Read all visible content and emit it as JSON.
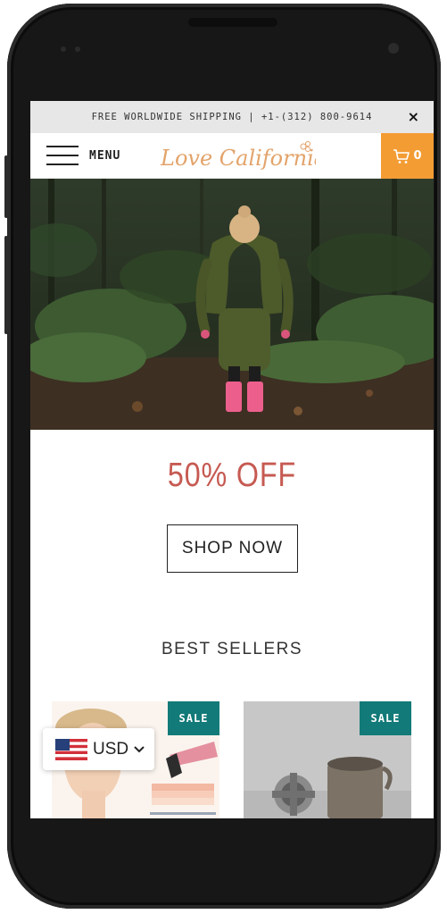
{
  "announcement": {
    "text": "FREE WORLDWIDE SHIPPING | +1-(312) 800-9614",
    "close_label": "×"
  },
  "header": {
    "menu_label": "MENU",
    "logo_text": "Love California",
    "cart_count": "0"
  },
  "promo": {
    "title": "50% OFF",
    "button_label": "SHOP NOW"
  },
  "best_sellers": {
    "heading": "BEST SELLERS",
    "products": [
      {
        "badge": "SALE"
      },
      {
        "badge": "SALE"
      }
    ]
  },
  "currency": {
    "code": "USD",
    "flag": "us-flag-icon"
  },
  "colors": {
    "cart_bg": "#f39c34",
    "promo_text": "#c65a52",
    "sale_badge": "#127a78",
    "logo_text": "#e3a36a"
  }
}
